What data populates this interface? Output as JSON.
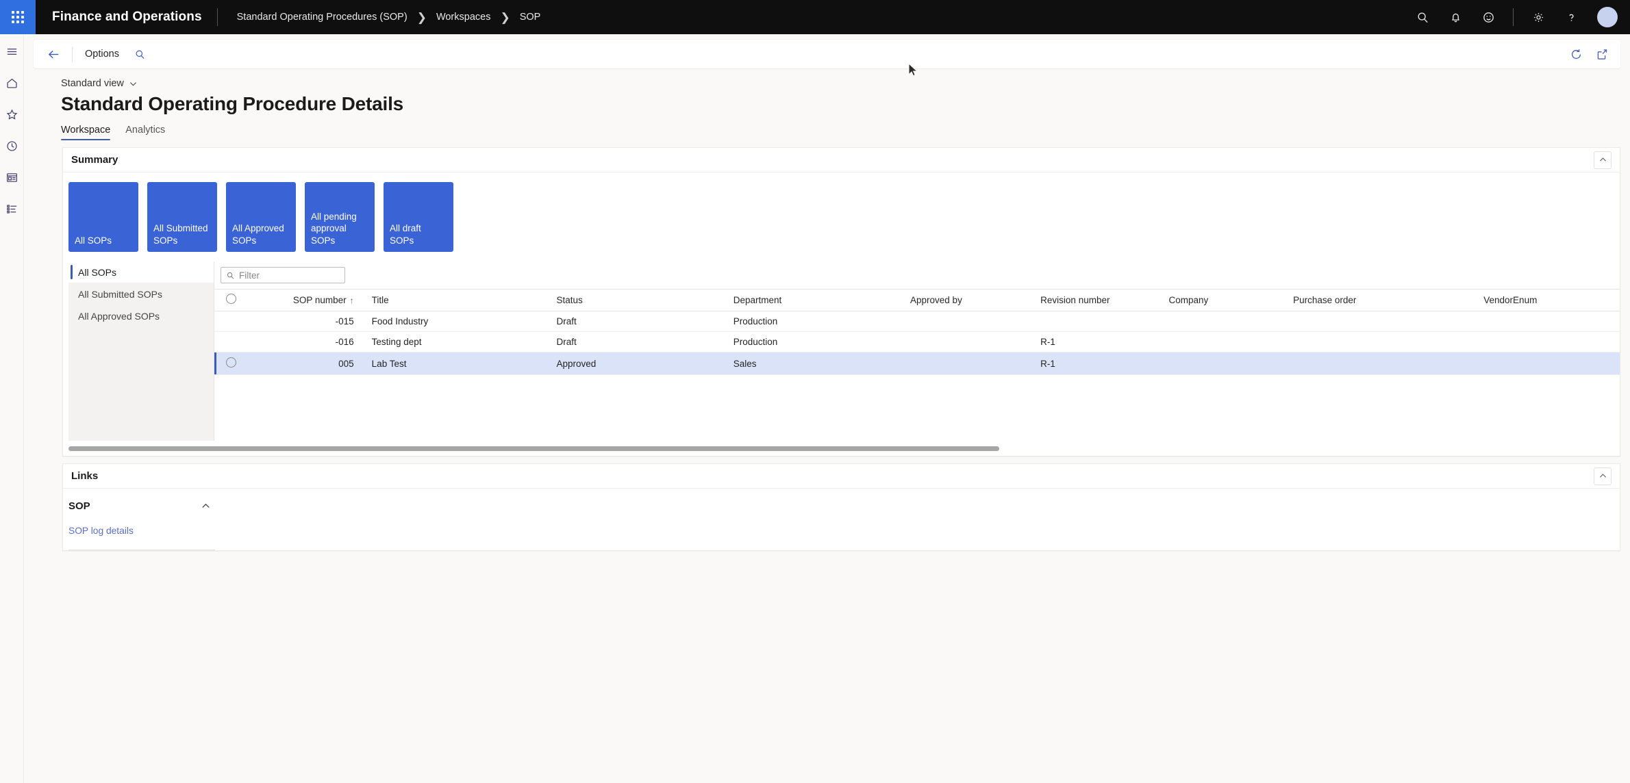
{
  "topnav": {
    "waffle_icon": "waffle-grid-icon",
    "brand": "Finance and Operations",
    "breadcrumbs": [
      "Standard Operating Procedures (SOP)",
      "Workspaces",
      "SOP"
    ],
    "icons": [
      "search-icon",
      "notifications-bell-icon",
      "feedback-smiley-icon",
      "settings-gear-icon",
      "help-question-icon"
    ],
    "avatar": "user-avatar"
  },
  "rail": {
    "items": [
      "hamburger-menu-icon",
      "home-icon",
      "favorites-star-icon",
      "recent-clock-icon",
      "workspaces-icon",
      "modules-list-icon"
    ]
  },
  "actionbar": {
    "back_icon": "back-arrow-icon",
    "options_label": "Options",
    "search_icon": "search-icon",
    "refresh_icon": "refresh-icon",
    "popout_icon": "open-in-new-window-icon"
  },
  "header": {
    "view_label": "Standard view",
    "view_chevron": "chevron-down-icon",
    "page_title": "Standard Operating Procedure Details",
    "tabs": [
      {
        "label": "Workspace",
        "active": true
      },
      {
        "label": "Analytics",
        "active": false
      }
    ]
  },
  "summary": {
    "title": "Summary",
    "collapse_icon": "chevron-up-icon",
    "tiles": [
      {
        "label": "All SOPs"
      },
      {
        "label": "All Submitted SOPs"
      },
      {
        "label": "All Approved SOPs"
      },
      {
        "label": "All pending approval SOPs"
      },
      {
        "label": "All draft SOPs"
      }
    ],
    "side_list": [
      {
        "label": "All SOPs",
        "selected": true
      },
      {
        "label": "All Submitted SOPs",
        "selected": false
      },
      {
        "label": "All Approved SOPs",
        "selected": false
      }
    ],
    "filter": {
      "placeholder": "Filter",
      "value": "",
      "icon": "search-icon"
    },
    "grid": {
      "columns": [
        "SOP number",
        "Title",
        "Status",
        "Department",
        "Approved by",
        "Revision number",
        "Company",
        "Purchase order",
        "VendorEnum"
      ],
      "sorted_column": "SOP number",
      "sort_direction": "ascending",
      "sort_glyph": "↑",
      "select_all_icon": "radio-unselected-icon",
      "rows": [
        {
          "selected": false,
          "sop_number": "-015",
          "title": "Food Industry",
          "status": "Draft",
          "department": "Production",
          "approved_by": "",
          "revision_number": "",
          "company": "",
          "purchase_order": "",
          "vendor_enum": ""
        },
        {
          "selected": false,
          "sop_number": "-016",
          "title": "Testing dept",
          "status": "Draft",
          "department": "Production",
          "approved_by": "",
          "revision_number": "R-1",
          "company": "",
          "purchase_order": "",
          "vendor_enum": ""
        },
        {
          "selected": true,
          "sop_number": "005",
          "title": "Lab Test",
          "status": "Approved",
          "department": "Sales",
          "approved_by": "",
          "revision_number": "R-1",
          "company": "",
          "purchase_order": "",
          "vendor_enum": ""
        }
      ]
    }
  },
  "links": {
    "title": "Links",
    "collapse_icon": "chevron-up-icon",
    "group_title": "SOP",
    "group_chevron": "chevron-up-icon",
    "items": [
      "SOP log details"
    ]
  },
  "colors": {
    "accent_blue": "#3a63d6",
    "nav_black": "#0f0f0f",
    "waffle_blue": "#2f6fdf",
    "link_blue": "#2f5bc4",
    "selected_row": "#dbe3f8",
    "page_bg": "#faf9f8"
  }
}
